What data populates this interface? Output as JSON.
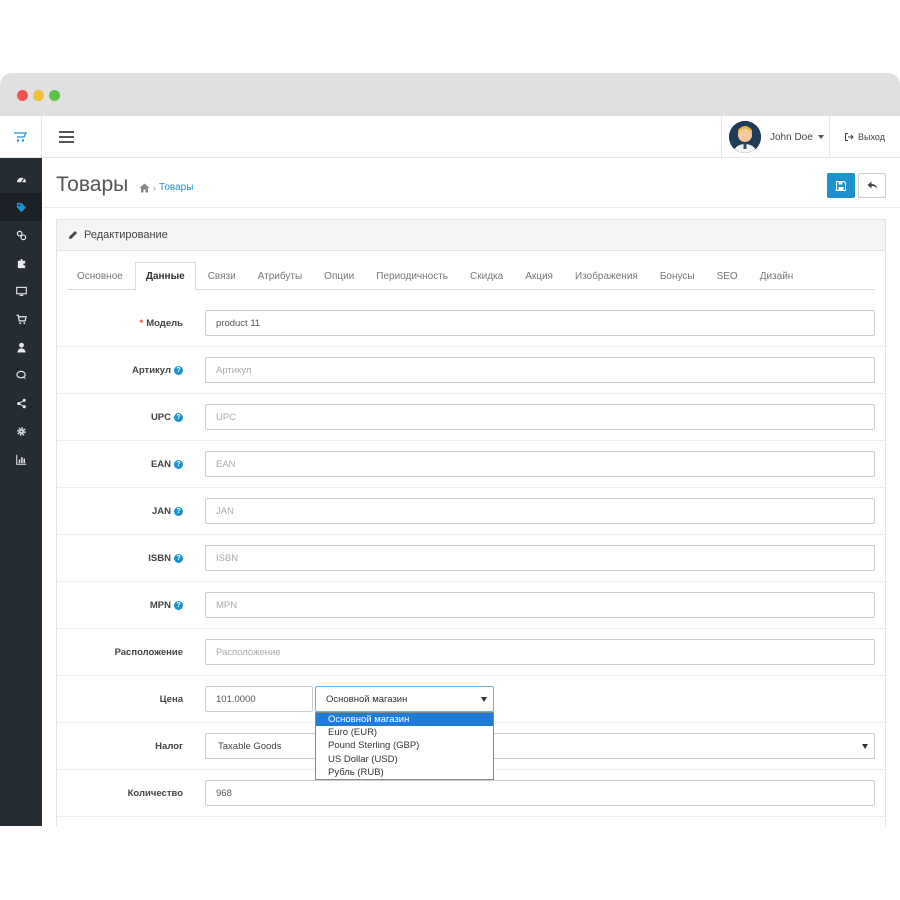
{
  "header": {
    "user_name": "John Doe",
    "logout_label": "Выход"
  },
  "page": {
    "title": "Товары",
    "breadcrumb_sep": "›",
    "breadcrumb_current": "Товары"
  },
  "panel": {
    "heading": "Редактирование"
  },
  "tabs": [
    {
      "label": "Основное",
      "active": false
    },
    {
      "label": "Данные",
      "active": true
    },
    {
      "label": "Связи",
      "active": false
    },
    {
      "label": "Атрибуты",
      "active": false
    },
    {
      "label": "Опции",
      "active": false
    },
    {
      "label": "Периодичность",
      "active": false
    },
    {
      "label": "Скидка",
      "active": false
    },
    {
      "label": "Акция",
      "active": false
    },
    {
      "label": "Изображения",
      "active": false
    },
    {
      "label": "Бонусы",
      "active": false
    },
    {
      "label": "SEO",
      "active": false
    },
    {
      "label": "Дизайн",
      "active": false
    }
  ],
  "form": {
    "model": {
      "label": "Модель",
      "value": "product 11",
      "placeholder": "Модель"
    },
    "sku": {
      "label": "Артикул",
      "value": "",
      "placeholder": "Артикул"
    },
    "upc": {
      "label": "UPC",
      "value": "",
      "placeholder": "UPC"
    },
    "ean": {
      "label": "EAN",
      "value": "",
      "placeholder": "EAN"
    },
    "jan": {
      "label": "JAN",
      "value": "",
      "placeholder": "JAN"
    },
    "isbn": {
      "label": "ISBN",
      "value": "",
      "placeholder": "ISBN"
    },
    "mpn": {
      "label": "MPN",
      "value": "",
      "placeholder": "MPN"
    },
    "location": {
      "label": "Расположение",
      "value": "",
      "placeholder": "Расположение"
    },
    "price": {
      "label": "Цена",
      "value": "101.0000",
      "currency_selected": "Основной магазин",
      "currency_options": [
        "Основной магазин",
        "Euro (EUR)",
        "Pound Sterling (GBP)",
        "US Dollar (USD)",
        "Рубль (RUB)"
      ]
    },
    "tax": {
      "label": "Налог",
      "value": "Taxable Goods"
    },
    "quantity": {
      "label": "Количество",
      "value": "968"
    }
  },
  "sidebar_icons": [
    "dashboard-icon",
    "tag-icon",
    "puzzle-link-icon",
    "puzzle-icon",
    "monitor-icon",
    "cart-icon",
    "user-icon",
    "comments-icon",
    "share-icon",
    "gear-icon",
    "bar-chart-icon"
  ],
  "colors": {
    "accent": "#1e91cf",
    "sidebar_bg": "#262c33",
    "required": "#e3503e",
    "dropdown_selected": "#1e7bd6"
  }
}
